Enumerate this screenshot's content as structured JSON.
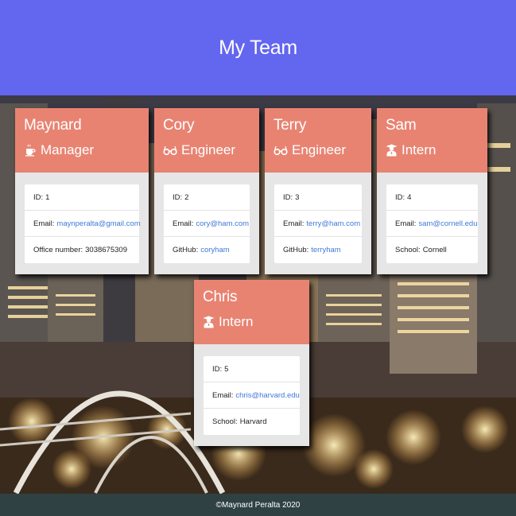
{
  "header": {
    "title": "My Team"
  },
  "footer": {
    "text": "©Maynard Peralta 2020"
  },
  "colors": {
    "header": "#6366ef",
    "card_top": "#e88372",
    "footer": "#2f4143",
    "link": "#3f79d8"
  },
  "employees": [
    {
      "name": "Maynard",
      "role": "Manager",
      "icon": "coffee-icon",
      "id_label": "ID:",
      "id": "1",
      "email_label": "Email:",
      "email": "maynperalta@gmail.com",
      "extra_label": "Office number:",
      "extra": "3038675309"
    },
    {
      "name": "Cory",
      "role": "Engineer",
      "icon": "glasses-icon",
      "id_label": "ID:",
      "id": "2",
      "email_label": "Email:",
      "email": "cory@ham.com",
      "extra_label": "GitHub:",
      "extra": "coryham"
    },
    {
      "name": "Terry",
      "role": "Engineer",
      "icon": "glasses-icon",
      "id_label": "ID:",
      "id": "3",
      "email_label": "Email:",
      "email": "terry@ham.com",
      "extra_label": "GitHub:",
      "extra": "terryham"
    },
    {
      "name": "Sam",
      "role": "Intern",
      "icon": "graduate-icon",
      "id_label": "ID:",
      "id": "4",
      "email_label": "Email:",
      "email": "sam@cornell.edu",
      "extra_label": "School:",
      "extra": "Cornell"
    },
    {
      "name": "Chris",
      "role": "Intern",
      "icon": "graduate-icon",
      "id_label": "ID:",
      "id": "5",
      "email_label": "Email:",
      "email": "chris@harvard.edu",
      "extra_label": "School:",
      "extra": "Harvard"
    }
  ]
}
